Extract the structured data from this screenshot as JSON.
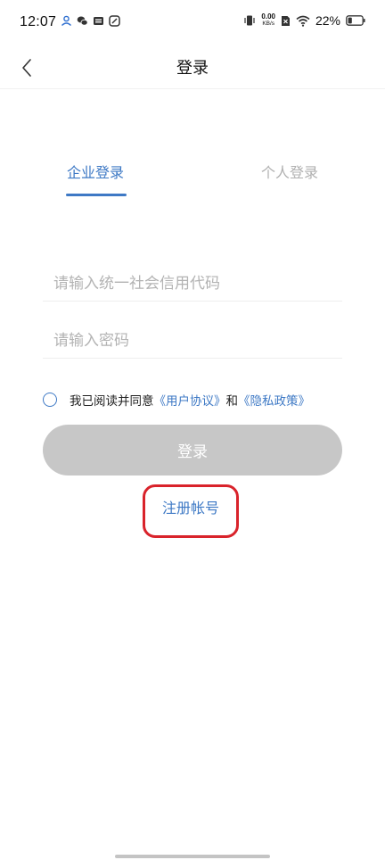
{
  "status_bar": {
    "time": "12:07",
    "net_speed_value": "0.00",
    "net_speed_unit": "KB/s",
    "battery": "22%",
    "icons": [
      "app-notification-icon",
      "wechat-icon",
      "mail-icon",
      "app-icon",
      "vibrate-icon",
      "sim-icon",
      "wifi-icon",
      "battery-icon"
    ]
  },
  "header": {
    "title": "登录",
    "back_icon": "chevron-left-icon"
  },
  "tabs": {
    "enterprise": "企业登录",
    "personal": "个人登录",
    "active": "enterprise"
  },
  "form": {
    "code_placeholder": "请输入统一社会信用代码",
    "password_placeholder": "请输入密码"
  },
  "agreement": {
    "prefix": "我已阅读并同意",
    "user_agreement": "《用户协议》",
    "and": "和",
    "privacy_policy": "《隐私政策》",
    "checked": false
  },
  "login_button": "登录",
  "register_link": "注册帐号",
  "colors": {
    "accent": "#3e79c5",
    "disabled_button": "#c7c7c7",
    "highlight": "#d9232b"
  }
}
